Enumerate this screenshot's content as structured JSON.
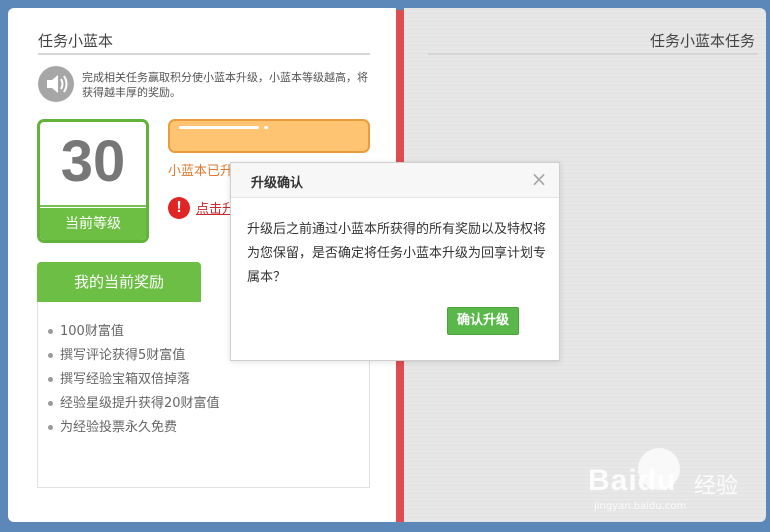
{
  "left_page": {
    "title": "任务小蓝本",
    "intro": "完成相关任务赢取积分使小蓝本升级，小蓝本等级越高，将获得越丰厚的奖励。",
    "icon": "speaker-icon",
    "level": {
      "value": "30",
      "label": "当前等级"
    },
    "status_text": "小蓝本已升",
    "alert_link": "点击升",
    "alert_icon": "exclamation-icon",
    "rewards": {
      "tab_label": "我的当前奖励",
      "items": [
        "100财富值",
        "撰写评论获得5财富值",
        "撰写经验宝箱双倍掉落",
        "经验星级提升获得20财富值",
        "为经验投票永久免费"
      ]
    }
  },
  "right_page": {
    "title": "任务小蓝本任务"
  },
  "dialog": {
    "title": "升级确认",
    "close_icon": "close-icon",
    "body": "升级后之前通过小蓝本所获得的所有奖励以及特权将为您保留，是否确定将任务小蓝本升级为回享计划专属本？",
    "confirm_label": "确认升级"
  },
  "watermark": {
    "brand": "Baidu",
    "brand_cn": "经验",
    "url": "jingyan.baidu.com"
  },
  "colors": {
    "accent_green": "#6cbf42",
    "progress_orange": "#ffc471",
    "spine_red": "#df4d50",
    "background_blue": "#5b88b8"
  }
}
